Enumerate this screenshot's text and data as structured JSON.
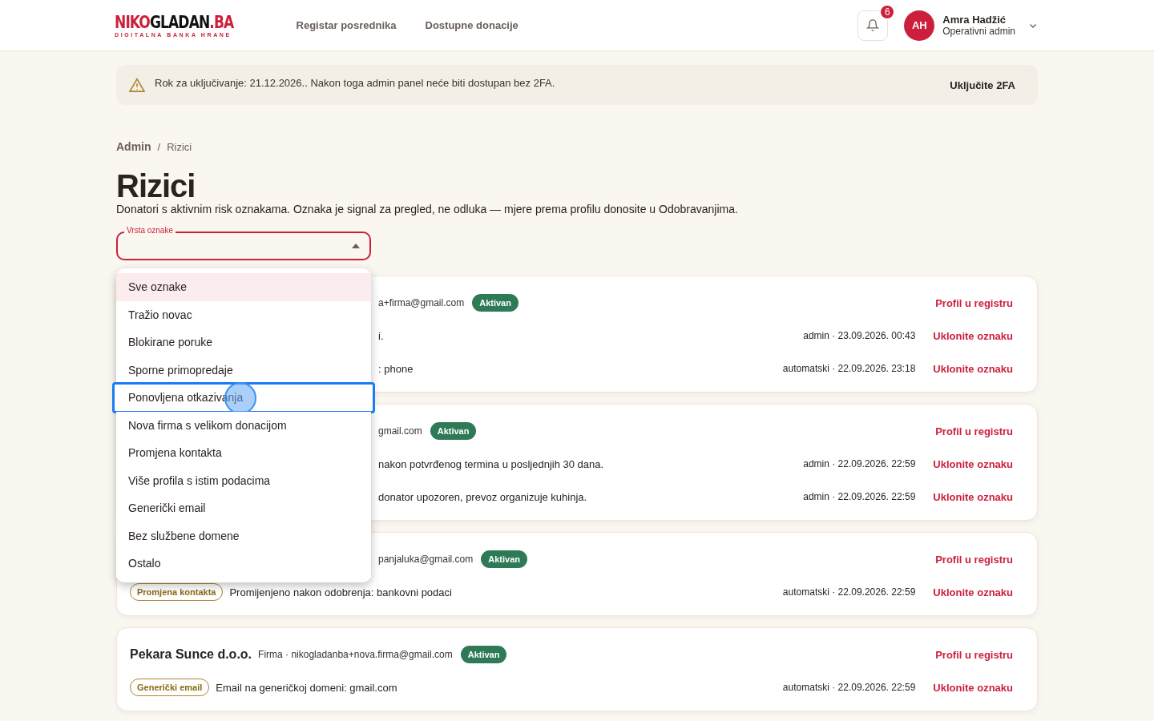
{
  "header": {
    "logo": {
      "parts": [
        {
          "text": "NIKO",
          "kind": "accent"
        },
        {
          "text": "GLADAN",
          "kind": "plain"
        },
        {
          "text": ".BA",
          "kind": "accent"
        }
      ],
      "tagline": "DIGITALNA BANKA HRANE"
    },
    "nav": [
      "Registar posrednika",
      "Dostupne donacije"
    ],
    "notifications": {
      "count": "6"
    },
    "user": {
      "initials": "AH",
      "name": "Amra Hadžić",
      "role": "Operativni admin"
    }
  },
  "banner": {
    "text": "Rok za uključivanje: 21.12.2026.. Nakon toga admin panel neće biti dostupan bez 2FA.",
    "action": "Uključite 2FA"
  },
  "breadcrumb": [
    "Admin",
    "Rizici"
  ],
  "breadcrumb_separator": "/",
  "title": "Rizici",
  "subtitle": "Donatori s aktivnim risk oznakama. Oznaka je signal za pregled, ne odluka — mjere prema profilu donosite u Odobravanjima.",
  "filter": {
    "label": "Vrsta oznake",
    "expanded": true,
    "options": [
      {
        "label": "Sve oznake",
        "selected": true,
        "focused": false
      },
      {
        "label": "Tražio novac",
        "selected": false,
        "focused": false
      },
      {
        "label": "Blokirane poruke",
        "selected": false,
        "focused": false
      },
      {
        "label": "Sporne primopredaje",
        "selected": false,
        "focused": false
      },
      {
        "label": "Ponovljena otkazivanja",
        "selected": false,
        "focused": true
      },
      {
        "label": "Nova firma s velikom donacijom",
        "selected": false,
        "focused": false
      },
      {
        "label": "Promjena kontakta",
        "selected": false,
        "focused": false
      },
      {
        "label": "Više profila s istim podacima",
        "selected": false,
        "focused": false
      },
      {
        "label": "Generički email",
        "selected": false,
        "focused": false
      },
      {
        "label": "Bez službene domene",
        "selected": false,
        "focused": false
      },
      {
        "label": "Ostalo",
        "selected": false,
        "focused": false
      }
    ]
  },
  "donors": [
    {
      "covered": true,
      "meta": "a+firma@gmail.com",
      "status": "Aktivan",
      "link": "Profil u registru",
      "flags": [
        {
          "covered": true,
          "text": "i.",
          "source": "admin · 23.09.2026. 00:43",
          "action": "Uklonite oznaku"
        },
        {
          "covered": true,
          "text": ": phone",
          "source": "automatski · 22.09.2026. 23:18",
          "action": "Uklonite oznaku"
        }
      ]
    },
    {
      "covered": true,
      "meta": "gmail.com",
      "status": "Aktivan",
      "link": "Profil u registru",
      "flags": [
        {
          "covered": true,
          "text": "nakon potvrđenog termina u posljednjih 30 dana.",
          "source": "admin · 22.09.2026. 22:59",
          "action": "Uklonite oznaku"
        },
        {
          "covered": true,
          "text": "donator upozoren, prevoz organizuje kuhinja.",
          "source": "admin · 22.09.2026. 22:59",
          "action": "Uklonite oznaku"
        }
      ]
    },
    {
      "covered": true,
      "meta": "panjaluka@gmail.com",
      "status": "Aktivan",
      "link": "Profil u registru",
      "flags": [
        {
          "covered": false,
          "tag": "Promjena kontakta",
          "text": "Promijenjeno nakon odobrenja: bankovni podaci",
          "source": "automatski · 22.09.2026. 22:59",
          "action": "Uklonite oznaku"
        }
      ]
    },
    {
      "covered": false,
      "name": "Pekara Sunce d.o.o.",
      "meta": "Firma · nikogladanba+nova.firma@gmail.com",
      "status": "Aktivan",
      "link": "Profil u registru",
      "flags": [
        {
          "covered": false,
          "tag": "Generički email",
          "text": "Email na generičkoj domeni: gmail.com",
          "source": "automatski · 22.09.2026. 22:59",
          "action": "Uklonite oznaku"
        }
      ]
    }
  ]
}
